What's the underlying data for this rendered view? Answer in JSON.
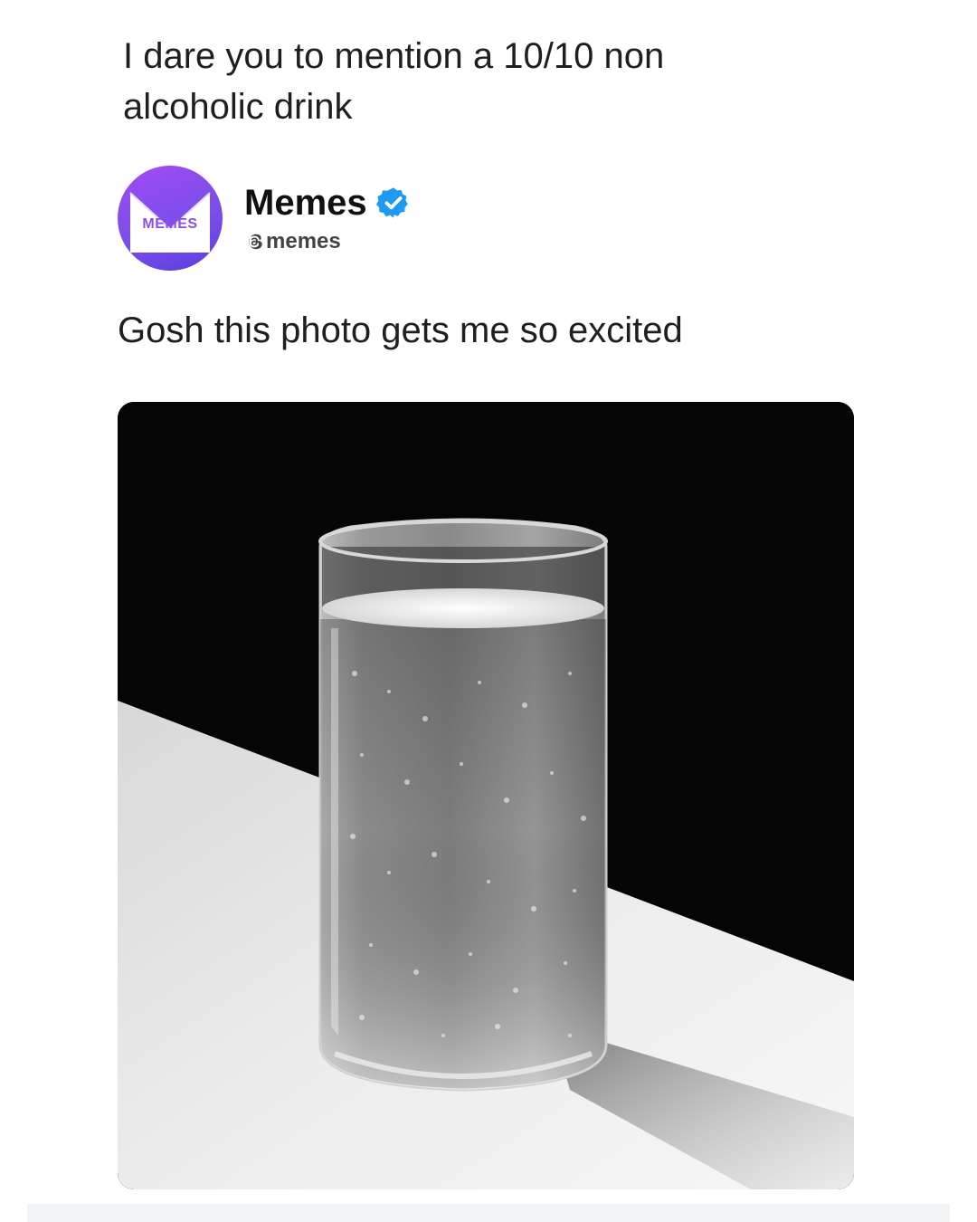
{
  "caption": {
    "text": "I dare you to mention a 10/10 non alcoholic drink"
  },
  "post": {
    "author": {
      "avatar_label": "MEMES",
      "display_name": "Memes",
      "verified": true,
      "handle": "memes"
    },
    "text": "Gosh this photo gets me so excited",
    "media": {
      "icon": "glass-of-water-photo"
    }
  },
  "colors": {
    "avatar_gradient_start": "#a24bf2",
    "avatar_gradient_end": "#5d3ce0",
    "verified_badge": "#1d9bf0",
    "text": "#1f1f1f"
  }
}
